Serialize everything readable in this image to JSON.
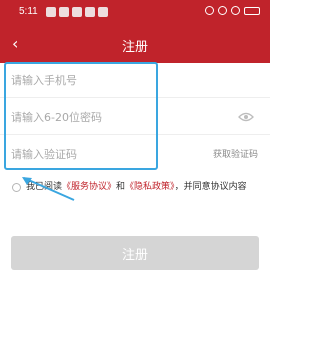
{
  "status_bar": {
    "time": "5:11"
  },
  "header": {
    "back_icon": "chevron-left-icon",
    "title": "注册"
  },
  "form": {
    "phone_placeholder": "请输入手机号",
    "password_placeholder": "请输入6-20位密码",
    "code_placeholder": "请输入验证码",
    "get_code_label": "获取验证码"
  },
  "agreement": {
    "prefix": "我已阅读",
    "service_link": "《服务协议》",
    "conjunction": "和",
    "privacy_link": "《隐私政策》",
    "suffix": "，并同意协议内容"
  },
  "submit": {
    "label": "注册"
  },
  "colors": {
    "brand": "#c0232b",
    "annotation": "#3aa6e0",
    "disabled_button": "#d5d5d5"
  }
}
